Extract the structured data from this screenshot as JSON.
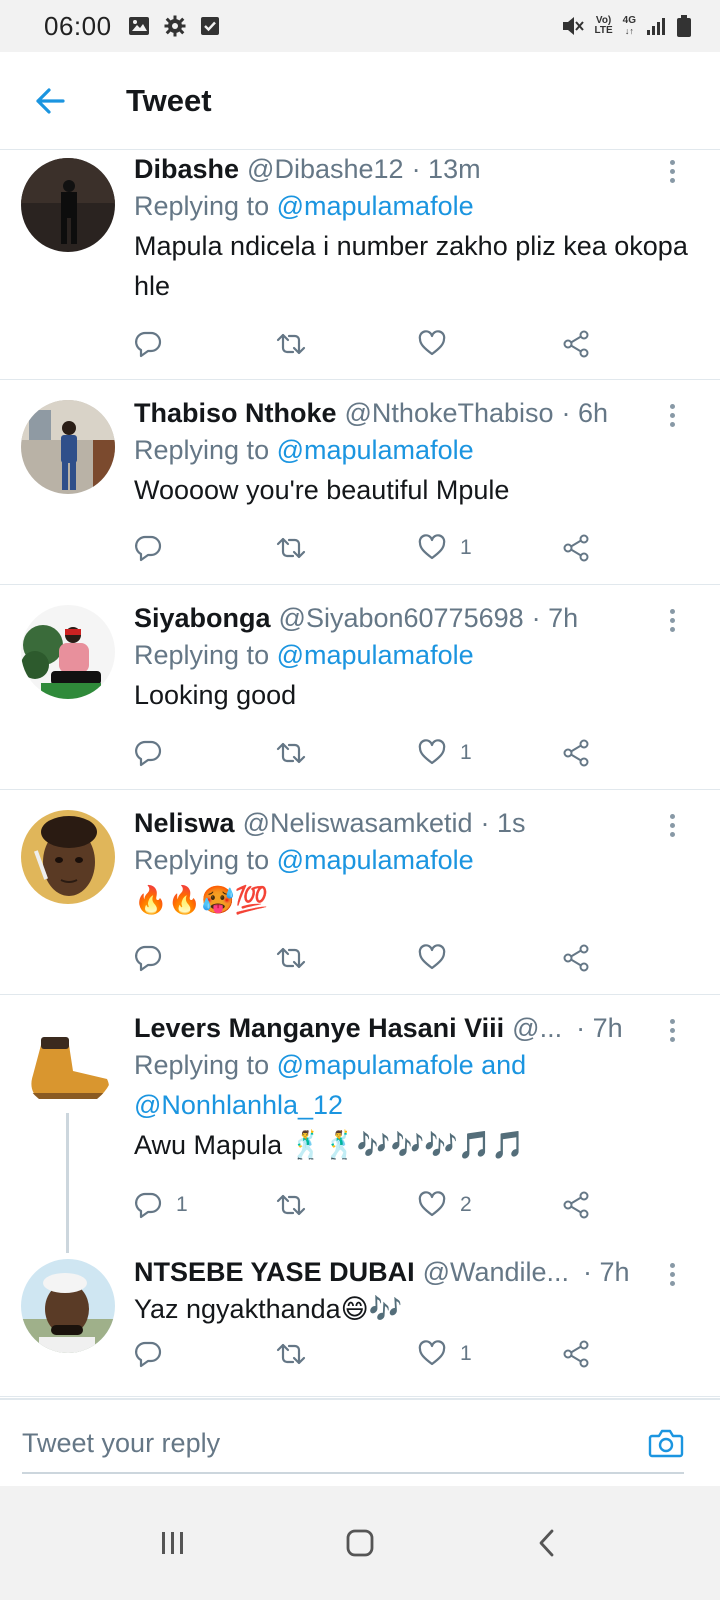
{
  "status_bar": {
    "time": "06:00",
    "network_lte": "LTE",
    "network_vo": "Vo)",
    "network_4g": "4G"
  },
  "header": {
    "title": "Tweet"
  },
  "colors": {
    "accent": "#1b95e0",
    "text": "#14171a",
    "secondary": "#657786",
    "divider": "#e1e8ed"
  },
  "tweets": [
    {
      "name": "Dibashe",
      "handle": "@Dibashe12",
      "time": "· 13m",
      "replying_prefix": "Replying to ",
      "replying_to": "@mapulamafole",
      "text": "Mapula ndicela i number zakho pliz kea okopa hle",
      "reply_count": "",
      "retweet_count": "",
      "like_count": ""
    },
    {
      "name": "Thabiso Nthoke",
      "handle": "@NthokeThabiso",
      "time": "· 6h",
      "replying_prefix": "Replying to ",
      "replying_to": "@mapulamafole",
      "text": "Woooow you're beautiful Mpule",
      "reply_count": "",
      "retweet_count": "",
      "like_count": "1"
    },
    {
      "name": "Siyabonga",
      "handle": "@Siyabon60775698",
      "time": "· 7h",
      "replying_prefix": "Replying to ",
      "replying_to": "@mapulamafole",
      "text": "Looking good",
      "reply_count": "",
      "retweet_count": "",
      "like_count": "1"
    },
    {
      "name": "Neliswa",
      "handle": "@Neliswasamketid",
      "time": "· 1s",
      "replying_prefix": "Replying to ",
      "replying_to": "@mapulamafole",
      "text": "🔥🔥🥵💯",
      "reply_count": "",
      "retweet_count": "",
      "like_count": ""
    },
    {
      "name": "Levers Manganye Hasani Viii",
      "handle": "@...",
      "time": "· 7h",
      "replying_prefix": "Replying to ",
      "replying_to": "@mapulamafole and",
      "replying_to_2": "@Nonhlanhla_12",
      "text": "Awu Mapula 🕺🕺🎶🎶🎶🎵🎵",
      "reply_count": "1",
      "retweet_count": "",
      "like_count": "2"
    },
    {
      "name": "NTSEBE YASE DUBAI",
      "handle": "@Wandile...",
      "time": "· 7h",
      "text": "Yaz ngyakthanda😄🎶",
      "reply_count": "",
      "retweet_count": "",
      "like_count": "1"
    }
  ],
  "reply_bar": {
    "placeholder": "Tweet your reply"
  },
  "icons": {
    "back": "arrow-left-icon",
    "reply": "comment-icon",
    "retweet": "retweet-icon",
    "like": "heart-icon",
    "share": "share-icon",
    "more": "more-vertical-icon",
    "camera": "camera-icon"
  }
}
